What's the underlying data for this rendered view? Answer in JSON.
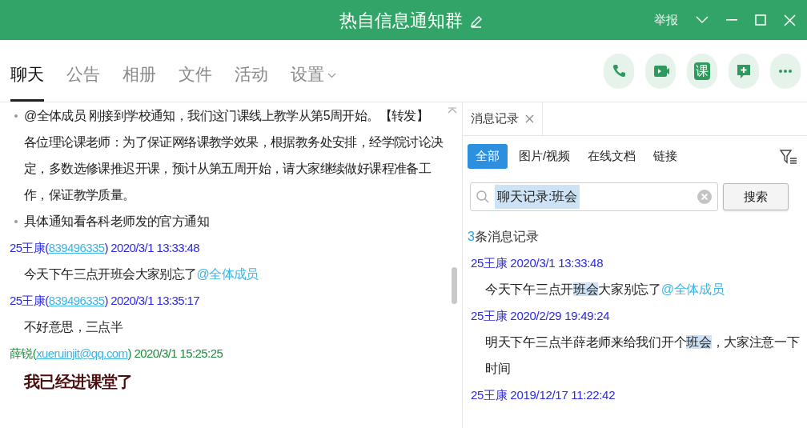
{
  "window": {
    "title": "热自信息通知群",
    "report": "举报"
  },
  "tabs": [
    {
      "label": "聊天",
      "selected": true
    },
    {
      "label": "公告",
      "selected": false
    },
    {
      "label": "相册",
      "selected": false
    },
    {
      "label": "文件",
      "selected": false
    },
    {
      "label": "活动",
      "selected": false
    },
    {
      "label": "设置",
      "selected": false,
      "has_menu": true
    }
  ],
  "actions": [
    {
      "kind": "phone"
    },
    {
      "kind": "video"
    },
    {
      "kind": "text",
      "label": "课"
    },
    {
      "kind": "add-comment"
    },
    {
      "kind": "more"
    }
  ],
  "chat": [
    {
      "kind": "bullet",
      "lines": [
        "@全体成员 刚接到学校通知，我们这门课线上教学从第5周开始。【转发】",
        "各位理论课老师：为了保证网络课教学效果，根据教务处安排，经学院讨论决定，多数选修课推迟开课，预计从第五周开始，请大家继续做好课程准备工作，保证教学质量。"
      ]
    },
    {
      "kind": "bullet",
      "lines": [
        "具体通知看各科老师发的官方通知"
      ]
    },
    {
      "kind": "header",
      "color": "#2a2ae0",
      "segments": [
        {
          "kind": "plain",
          "text": "25王康("
        },
        {
          "kind": "link",
          "text": "839496335"
        },
        {
          "kind": "plain",
          "text": ") 2020/3/1 13:33:48"
        }
      ]
    },
    {
      "kind": "message",
      "segments": [
        {
          "kind": "plain",
          "text": "今天下午三点开班会大家别忘了"
        },
        {
          "kind": "mention",
          "text": "@全体成员"
        }
      ]
    },
    {
      "kind": "header",
      "color": "#2a2ae0",
      "segments": [
        {
          "kind": "plain",
          "text": "25王康("
        },
        {
          "kind": "link",
          "text": "839496335"
        },
        {
          "kind": "plain",
          "text": ") 2020/3/1 13:35:17"
        }
      ]
    },
    {
      "kind": "message",
      "segments": [
        {
          "kind": "plain",
          "text": "不好意思，三点半"
        }
      ]
    },
    {
      "kind": "header",
      "color": "#1e8a3c",
      "segments": [
        {
          "kind": "plain",
          "text": "薛锐("
        },
        {
          "kind": "link",
          "text": "xueruinjit@qq.com"
        },
        {
          "kind": "plain",
          "text": ") 2020/3/1 15:25:25"
        }
      ]
    },
    {
      "kind": "emphasis",
      "segments": [
        {
          "kind": "plain",
          "text": "我已经进课堂了"
        }
      ]
    }
  ],
  "history": {
    "tab": "消息记录",
    "filters": [
      {
        "label": "全部",
        "selected": true
      },
      {
        "label": "图片/视频",
        "selected": false
      },
      {
        "label": "在线文档",
        "selected": false
      },
      {
        "label": "链接",
        "selected": false
      }
    ],
    "search": {
      "value": "聊天记录:班会",
      "button": "搜索"
    },
    "count": "3",
    "count_label": "条消息记录",
    "results": [
      {
        "kind": "header",
        "color": "#2a2ae0",
        "segments": [
          {
            "kind": "plain",
            "text": "25王康 2020/3/1 13:33:48"
          }
        ]
      },
      {
        "kind": "message",
        "segments": [
          {
            "kind": "plain",
            "text": "今天下午三点开"
          },
          {
            "kind": "highlight",
            "text": "班会"
          },
          {
            "kind": "plain",
            "text": "大家别忘了"
          },
          {
            "kind": "mention",
            "text": "@全体成员"
          }
        ]
      },
      {
        "kind": "header",
        "color": "#2a2ae0",
        "segments": [
          {
            "kind": "plain",
            "text": "25王康 2020/2/29 19:49:24"
          }
        ]
      },
      {
        "kind": "message",
        "segments": [
          {
            "kind": "plain",
            "text": "明天下午三点半薛老师来给我们开个"
          },
          {
            "kind": "highlight",
            "text": "班会"
          },
          {
            "kind": "plain",
            "text": "，大家注意一下时间"
          }
        ]
      },
      {
        "kind": "header",
        "color": "#2a2ae0",
        "segments": [
          {
            "kind": "plain",
            "text": "25王康 2019/12/17 11:22:42"
          }
        ]
      }
    ]
  }
}
